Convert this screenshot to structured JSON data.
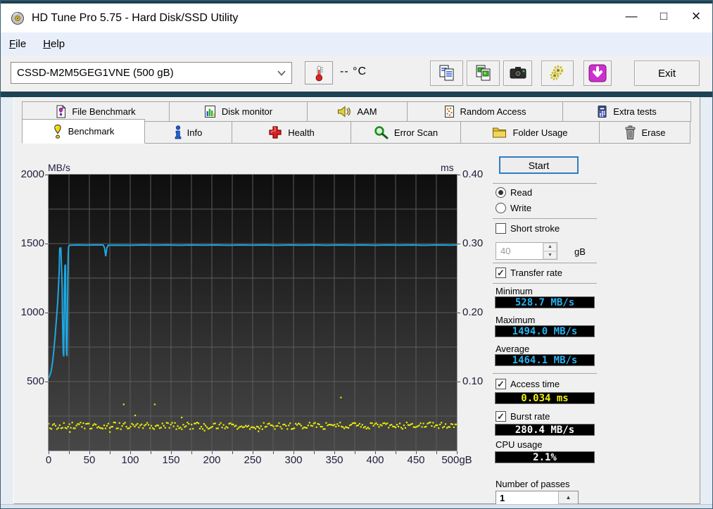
{
  "window": {
    "title": "HD Tune Pro 5.75 - Hard Disk/SSD Utility",
    "caption": {
      "minimize": "—",
      "maximize": "□",
      "close": "×"
    }
  },
  "menu": {
    "file": "File",
    "help": "Help"
  },
  "toolbar": {
    "drive_select": {
      "value": "CSSD-M2M5GEG1VNE (500 gB)"
    },
    "temperature": {
      "value": "--",
      "unit": "°C"
    },
    "exit_label": "Exit"
  },
  "tabs": {
    "row1": [
      {
        "label": "File Benchmark"
      },
      {
        "label": "Disk monitor"
      },
      {
        "label": "AAM"
      },
      {
        "label": "Random Access"
      },
      {
        "label": "Extra tests"
      }
    ],
    "row2": [
      {
        "label": "Benchmark",
        "active": true
      },
      {
        "label": "Info"
      },
      {
        "label": "Health"
      },
      {
        "label": "Error Scan"
      },
      {
        "label": "Folder Usage"
      },
      {
        "label": "Erase"
      }
    ]
  },
  "controls": {
    "start_label": "Start",
    "read_label": "Read",
    "write_label": "Write",
    "read_selected": true,
    "short_stroke_label": "Short stroke",
    "short_stroke_checked": false,
    "capacity_value": "40",
    "capacity_unit": "gB",
    "transfer_rate_label": "Transfer rate",
    "transfer_rate_checked": true,
    "minimum_label": "Minimum",
    "minimum_value": "528.7 MB/s",
    "maximum_label": "Maximum",
    "maximum_value": "1494.0 MB/s",
    "average_label": "Average",
    "average_value": "1464.1 MB/s",
    "access_time_label": "Access time",
    "access_time_checked": true,
    "access_time_value": "0.034 ms",
    "burst_rate_label": "Burst rate",
    "burst_rate_checked": true,
    "burst_rate_value": "280.4 MB/s",
    "cpu_usage_label": "CPU usage",
    "cpu_usage_value": "2.1%",
    "passes_label": "Number of passes",
    "passes_value": "1"
  },
  "glyphs": {
    "check": "✓",
    "spin_up": "▲",
    "spin_down": "▼"
  },
  "chart_data": {
    "type": "line",
    "title": "HD Tune benchmark: transfer rate (MB/s) and access time (ms) vs disk position (gB)",
    "left_axis": {
      "title": "MB/s",
      "min": 0,
      "max": 2000,
      "ticks": [
        "2000",
        "1500",
        "1000",
        "500"
      ]
    },
    "right_axis": {
      "title": "ms",
      "min": 0,
      "max": 0.4,
      "ticks": [
        "0.40",
        "0.30",
        "0.20",
        "0.10"
      ]
    },
    "x_axis": {
      "min": 0,
      "max": 500,
      "ticks": [
        "0",
        "50",
        "100",
        "150",
        "200",
        "250",
        "300",
        "350",
        "400",
        "450",
        "500gB"
      ]
    },
    "grid": {
      "x_step": 25,
      "y_step": 250,
      "color": "#5c5c5c"
    },
    "series": [
      {
        "name": "transfer-rate",
        "type": "line",
        "color": "#1fa7e1",
        "unit": "MB/s",
        "axis": "left",
        "points": [
          [
            0,
            525
          ],
          [
            1,
            538
          ],
          [
            2,
            552
          ],
          [
            3,
            572
          ],
          [
            4,
            605
          ],
          [
            5,
            648
          ],
          [
            6,
            700
          ],
          [
            7,
            762
          ],
          [
            8,
            830
          ],
          [
            9,
            902
          ],
          [
            10,
            980
          ],
          [
            11,
            1065
          ],
          [
            12,
            1165
          ],
          [
            13,
            1300
          ],
          [
            13.5,
            1455
          ],
          [
            14,
            1468
          ],
          [
            15,
            1468
          ],
          [
            15.5,
            1390
          ],
          [
            16,
            1305
          ],
          [
            16.6,
            1190
          ],
          [
            17,
            1000
          ],
          [
            17.5,
            830
          ],
          [
            18,
            705
          ],
          [
            18.6,
            682
          ],
          [
            19,
            880
          ],
          [
            19.5,
            1180
          ],
          [
            20,
            1335
          ],
          [
            20.6,
            1348
          ],
          [
            21,
            1120
          ],
          [
            21.5,
            830
          ],
          [
            22,
            705
          ],
          [
            22.6,
            685
          ],
          [
            23,
            905
          ],
          [
            23.5,
            1255
          ],
          [
            24,
            1415
          ],
          [
            24.6,
            1478
          ],
          [
            25.5,
            1487
          ],
          [
            28,
            1489
          ],
          [
            35,
            1490
          ],
          [
            45,
            1489
          ],
          [
            55,
            1490
          ],
          [
            67,
            1490
          ],
          [
            68.5,
            1470
          ],
          [
            70,
            1408
          ],
          [
            71.5,
            1470
          ],
          [
            73,
            1488
          ],
          [
            85,
            1489
          ],
          [
            100,
            1488
          ],
          [
            115,
            1490
          ],
          [
            130,
            1489
          ],
          [
            145,
            1490
          ],
          [
            160,
            1488
          ],
          [
            175,
            1490
          ],
          [
            190,
            1489
          ],
          [
            205,
            1490
          ],
          [
            220,
            1488
          ],
          [
            235,
            1490
          ],
          [
            250,
            1489
          ],
          [
            265,
            1490
          ],
          [
            280,
            1488
          ],
          [
            295,
            1490
          ],
          [
            310,
            1489
          ],
          [
            325,
            1490
          ],
          [
            340,
            1488
          ],
          [
            355,
            1490
          ],
          [
            370,
            1489
          ],
          [
            385,
            1490
          ],
          [
            400,
            1488
          ],
          [
            415,
            1490
          ],
          [
            430,
            1489
          ],
          [
            445,
            1490
          ],
          [
            460,
            1488
          ],
          [
            475,
            1490
          ],
          [
            490,
            1489
          ],
          [
            500,
            1490
          ]
        ]
      },
      {
        "name": "access-time",
        "type": "dots",
        "color": "#e9e909",
        "unit": "ms",
        "axis": "right",
        "band": {
          "x_start": 0,
          "x_end": 500,
          "x_step": 1.7,
          "y_mean": 0.036,
          "y_jitter": 0.005,
          "seed": 7
        },
        "outliers": [
          [
            92,
            0.067
          ],
          [
            106,
            0.051
          ],
          [
            130,
            0.067
          ],
          [
            163,
            0.048
          ],
          [
            358,
            0.077
          ],
          [
            26,
            0.027
          ],
          [
            75,
            0.027
          ],
          [
            191,
            0.029
          ],
          [
            257,
            0.028
          ]
        ]
      }
    ],
    "stats": {
      "transfer_minimum": "528.7 MB/s",
      "transfer_maximum": "1494.0 MB/s",
      "transfer_average": "1464.1 MB/s",
      "access_time": "0.034 ms",
      "burst_rate": "280.4 MB/s",
      "cpu_usage": "2.1%"
    }
  },
  "colors": {
    "accent_dark_teal": "#1d4354",
    "transfer_line": "#1fa7e1",
    "access_dots": "#e9e909",
    "value_cyan": "#29b1ef",
    "value_yellow": "#f0ee12",
    "save_button_magenta": "#cc2fcc"
  }
}
